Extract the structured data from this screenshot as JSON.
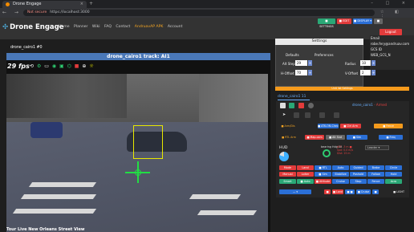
{
  "browser": {
    "tab_title": "Drone Engage",
    "tab_close": "×",
    "new_tab": "+",
    "window_controls": "– □ ×",
    "nav_buttons": "← → ⟳",
    "not_secure": "Not secure",
    "url": "https://localhost:3000",
    "right_icons": "☆ ◧ ⋮"
  },
  "site": {
    "logo": "Drone Engage",
    "nav": [
      "Home",
      "Planner",
      "Wiki",
      "FAQ",
      "Contact"
    ],
    "nav_highlight": "AndruavAP APK",
    "nav_account": "Account"
  },
  "top_buttons": {
    "b1": "■ SETTINGS",
    "b2": "■ EDIT",
    "b3": "■ DISPLAY ▾",
    "b4": "■"
  },
  "user": {
    "logout": "Logout",
    "email_label": "Email",
    "email": "robe.fery@andruav.com",
    "gcs_id_label": "GCS ID",
    "gcs_id": "WEB_GCS_N"
  },
  "stream": {
    "label": "drone_cairo1 #0",
    "track_title": "drone_cairo1 track: AI1",
    "fps": "29",
    "fps_unit": "fps",
    "caption": "Tour Live New Orleans Street View"
  },
  "settings": {
    "title": "Settings",
    "defaults": "Defaults",
    "preferences": "Preferences",
    "alt_step_label": "Alt Step",
    "alt_step": "29",
    "h_offset_label": "H-Offset",
    "h_offset": "70",
    "radius_label": "Radius",
    "radius": "10",
    "v_offset_label": "V-Offset",
    "v_offset": "2",
    "plus": "+"
  },
  "orange_bar": "Unit list Settings",
  "unit": {
    "tab": "drone_cairo1 11",
    "name": "drone_cairo1",
    "status": "- Armed"
  },
  "controls": {
    "r1": [
      "■ Arm/Dis",
      "■ RTL Arm",
      "■ Mode Arm",
      "✕ ■ Mode Sw"
    ],
    "r2": [
      "■ ATK-ON-Check",
      "■ Ctrl Arm",
      "■ Fence",
      "■ Freq"
    ],
    "r3": [
      "■ Gimbal",
      "■ Map-cam",
      "■ Alt Snd",
      "■ Sim"
    ]
  },
  "hud": {
    "label": "HUD",
    "pie_label": "Battery",
    "bearing": "bearing  Hdg 0d",
    "gps": [
      "ALT: -3 m  ■",
      "Spd: 0.0 m/s",
      "Dist: 15 m"
    ],
    "leader": "Leader ▾"
  },
  "modes": {
    "r1": [
      "Mode",
      "Land",
      "■ RTL",
      "Auto",
      "Guided",
      "Brake",
      "Circle"
    ],
    "r2": [
      "Manual",
      "Loiter",
      "■ Sim",
      "Stabilize",
      "Poshold",
      "Follow",
      "Hold"
    ],
    "r3": [
      "Smart",
      "■ Auto",
      "■ Altitude",
      "Cruise",
      "Stop",
      "Fence",
      "Acro"
    ]
  },
  "bottom": {
    "b1": "— ▾",
    "b2": "■",
    "b3": "■ Land",
    "b4": "■ ■",
    "b5": "■ Cruise",
    "b6": "■",
    "b7": "■ LIGHT"
  }
}
